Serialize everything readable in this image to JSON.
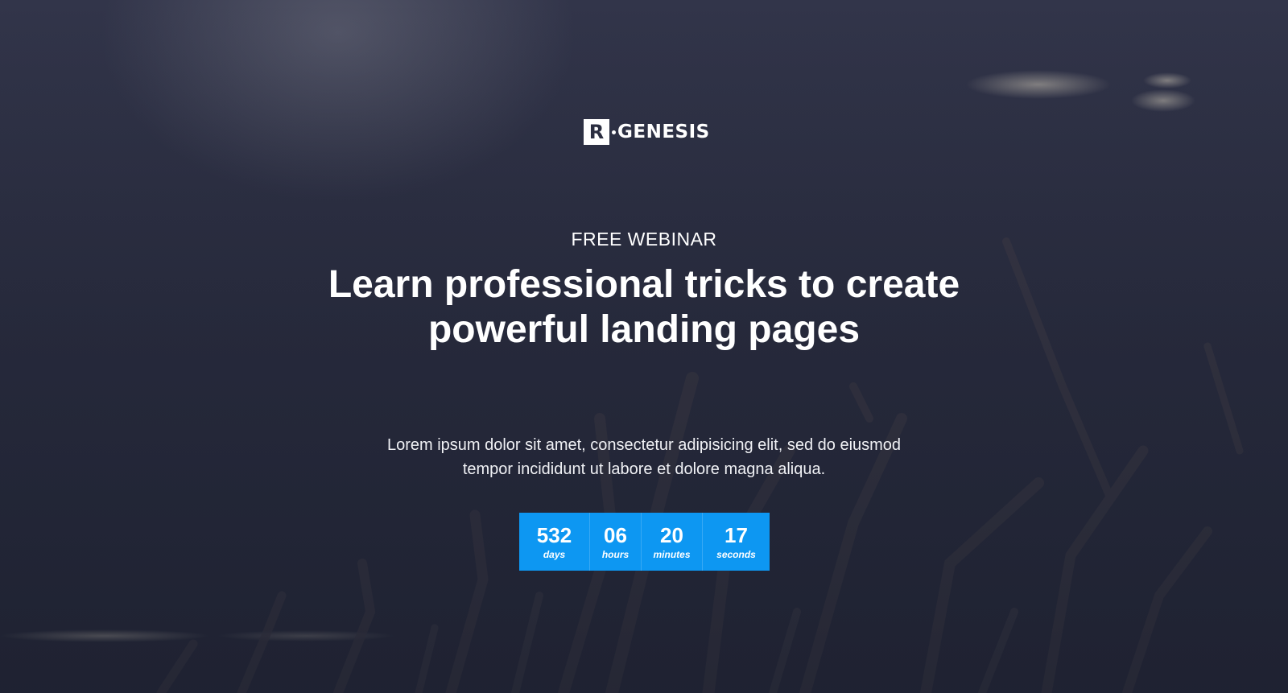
{
  "brand": {
    "mark_letter": "R",
    "name": "GENESIS"
  },
  "hero": {
    "eyebrow": "FREE WEBINAR",
    "headline_line1": "Learn professional tricks to create",
    "headline_line2": "powerful landing pages",
    "body_line1": "Lorem ipsum dolor sit amet, consectetur adipisicing elit, sed do eiusmod",
    "body_line2": "tempor incididunt ut labore et dolore magna aliqua."
  },
  "countdown": {
    "days": {
      "value": "532",
      "unit": "days"
    },
    "hours": {
      "value": "06",
      "unit": "hours"
    },
    "minutes": {
      "value": "20",
      "unit": "minutes"
    },
    "seconds": {
      "value": "17",
      "unit": "seconds"
    }
  },
  "colors": {
    "background": "#2a2d40",
    "countdown_bg": "#0d97f2",
    "text": "#ffffff"
  }
}
